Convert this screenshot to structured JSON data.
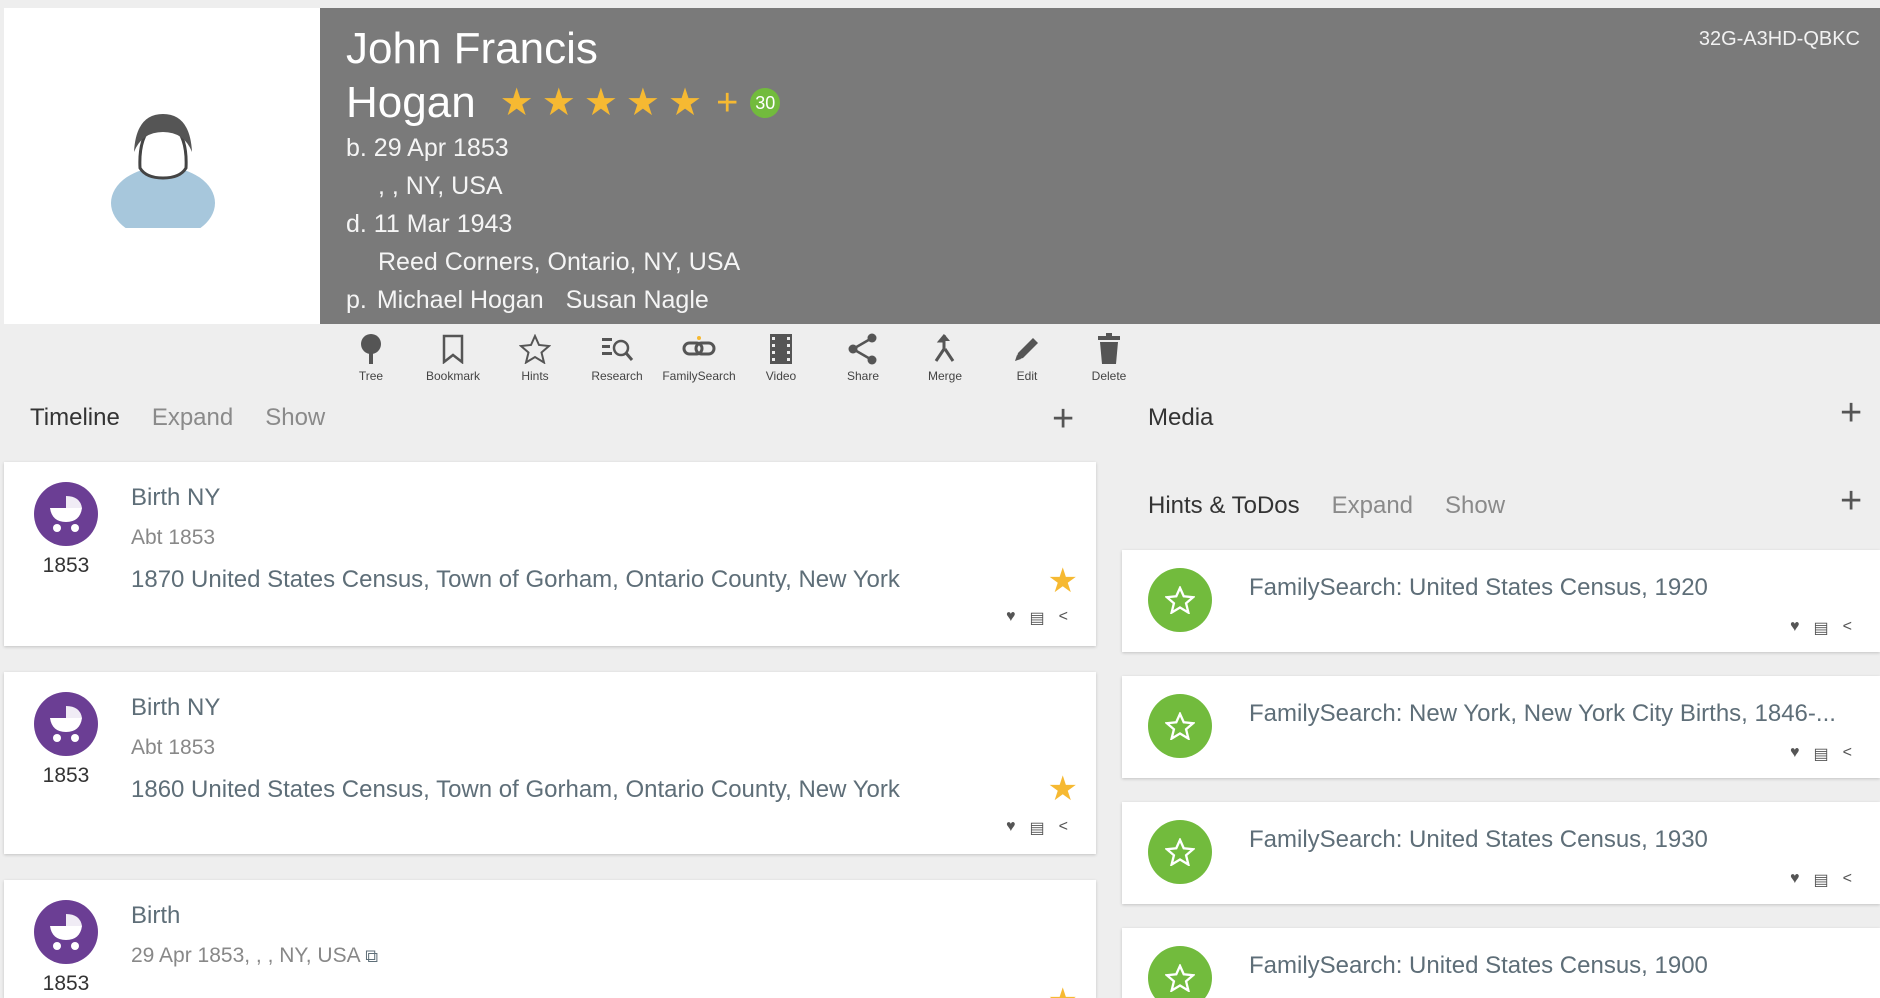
{
  "person": {
    "id": "32G-A3HD-QBKC",
    "first_names": "John Francis",
    "surname": "Hogan",
    "star_count": 5,
    "add_star": "+",
    "score_badge": "30",
    "birth_line": "b. 29 Apr 1853",
    "birth_place": ", , NY, USA",
    "death_line": "d. 11 Mar 1943",
    "death_place": "Reed Corners, Ontario, NY, USA",
    "parents_prefix": "p.",
    "father": "Michael Hogan",
    "mother": "Susan Nagle"
  },
  "toolbar": [
    {
      "label": "Tree",
      "icon": "tree-icon"
    },
    {
      "label": "Bookmark",
      "icon": "bookmark-icon"
    },
    {
      "label": "Hints",
      "icon": "star-outline-icon"
    },
    {
      "label": "Research",
      "icon": "research-icon"
    },
    {
      "label": "FamilySearch",
      "icon": "link-icon"
    },
    {
      "label": "Video",
      "icon": "film-icon"
    },
    {
      "label": "Share",
      "icon": "share-icon"
    },
    {
      "label": "Merge",
      "icon": "merge-icon"
    },
    {
      "label": "Edit",
      "icon": "pencil-icon"
    },
    {
      "label": "Delete",
      "icon": "trash-icon"
    }
  ],
  "timeline": {
    "title": "Timeline",
    "expand": "Expand",
    "show": "Show",
    "add": "+",
    "events": [
      {
        "year": "1853",
        "title": "Birth NY",
        "date": "Abt 1853",
        "desc": "1870 United States Census, Town of Gorham, Ontario County, New York",
        "starred": true
      },
      {
        "year": "1853",
        "title": "Birth NY",
        "date": "Abt 1853",
        "desc": "1860 United States Census, Town of Gorham, Ontario County, New York",
        "starred": true
      },
      {
        "year": "1853",
        "title": "Birth",
        "date": "29 Apr 1853,  , , NY, USA",
        "desc": "",
        "starred": true
      }
    ]
  },
  "media": {
    "title": "Media",
    "add": "+"
  },
  "hints": {
    "title": "Hints & ToDos",
    "expand": "Expand",
    "show": "Show",
    "add": "+",
    "items": [
      {
        "title": "FamilySearch: United States Census, 1920"
      },
      {
        "title": "FamilySearch: New York, New York City Births, 1846-..."
      },
      {
        "title": "FamilySearch: United States Census, 1930"
      },
      {
        "title": "FamilySearch: United States Census, 1900"
      }
    ]
  },
  "colors": {
    "header_bg": "#7a7a7a",
    "star": "#f6b932",
    "event_icon": "#6b3e94",
    "hint_icon": "#72bb3d",
    "link_text": "#5e6e78"
  }
}
